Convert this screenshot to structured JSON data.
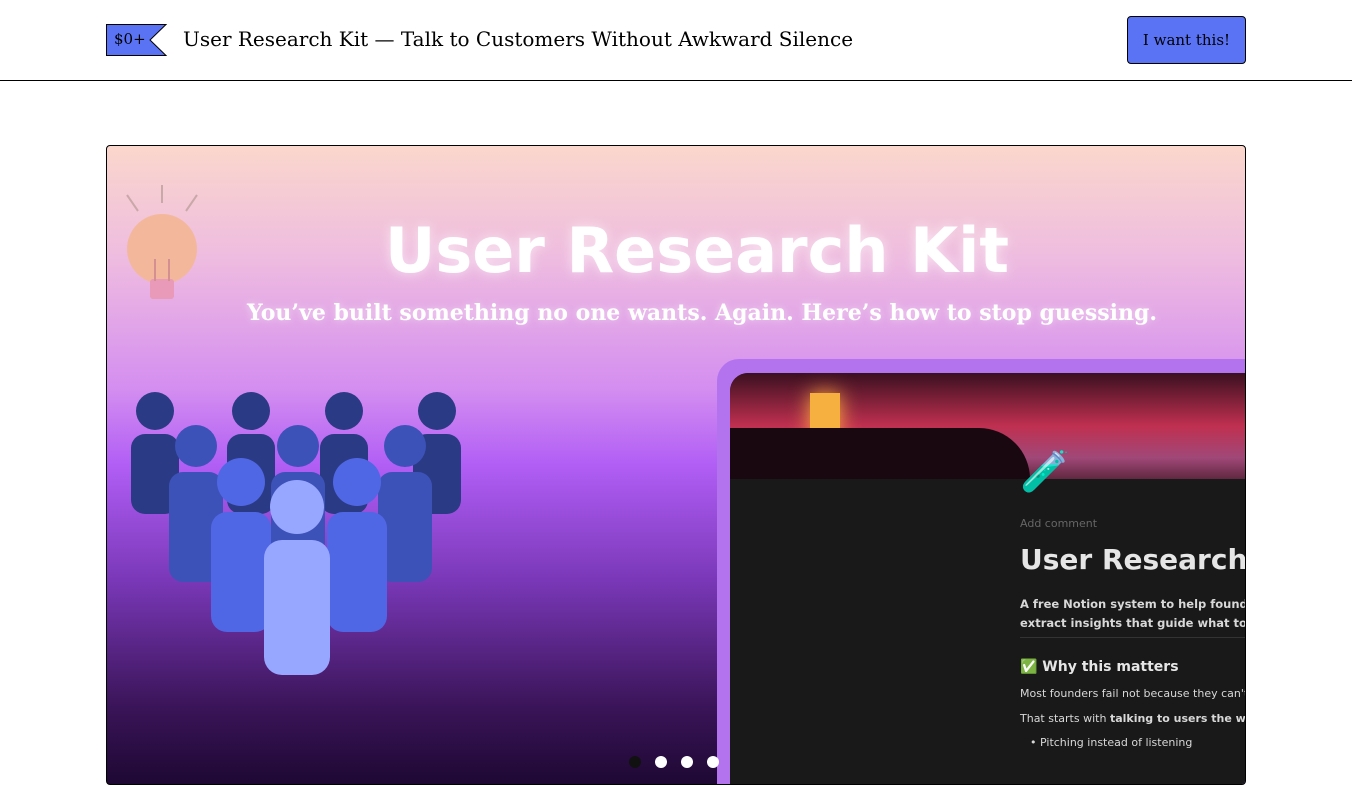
{
  "header": {
    "price": "$0+",
    "title": "User Research Kit — Talk to Customers Without Awkward Silence",
    "buy_label": "I want this!"
  },
  "hero": {
    "title": "User Research Kit",
    "subtitle": "You’ve built something no one wants. Again. Here’s how to stop guessing.",
    "notion": {
      "add_comment": "Add comment",
      "page_title": "User Research Kit",
      "description_line1": "A free Notion system to help founders t",
      "description_line2": "extract insights that guide what to build",
      "heading": "✅ Why this matters",
      "para1": "Most founders fail not because they can't",
      "para2_prefix": "That starts with ",
      "para2_bold": "talking to users the wrong",
      "bullet1": "Pitching instead of listening"
    },
    "carousel": {
      "count": 4,
      "active": 0
    }
  },
  "colors": {
    "accent": "#5a73f5"
  }
}
